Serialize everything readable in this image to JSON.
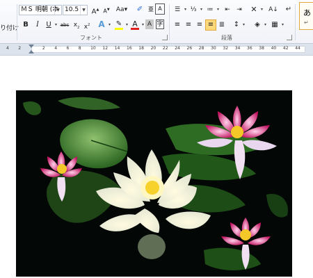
{
  "ribbon": {
    "clipboard_partial_label": "り付け",
    "font_name": "ＭＳ 明朝 (本",
    "font_size": "10.5",
    "font_group_label": "フォント",
    "paragraph_group_label": "段落",
    "styles_partial_label": "あ",
    "styles_sub": "↵"
  },
  "ruler": {
    "ticks": [
      "4",
      "2",
      "",
      "2",
      "4",
      "6",
      "8",
      "10",
      "12",
      "14",
      "16",
      "18",
      "20",
      "22",
      "24",
      "26",
      "28",
      "30",
      "32",
      "34",
      "36",
      "38",
      "40",
      "42",
      "44"
    ]
  },
  "colors": {
    "highlight": "#ffff00",
    "font_color": "#e02020",
    "selected_button": "#fbd97a"
  },
  "image": {
    "description_icon": "water-lily-photo"
  }
}
